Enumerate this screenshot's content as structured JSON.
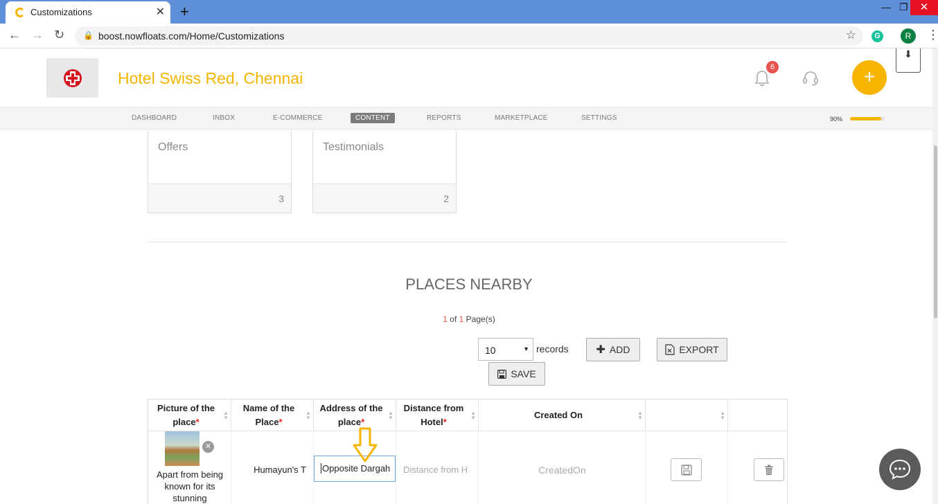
{
  "browser": {
    "tab_title": "Customizations",
    "url": "boost.nowfloats.com/Home/Customizations",
    "profile_initial": "R",
    "grammarly_initial": "G"
  },
  "header": {
    "hotel_name": "Hotel Swiss Red, Chennai",
    "notification_count": "6",
    "brand_color": "#f4b400"
  },
  "nav": {
    "items": [
      "DASHBOARD",
      "INBOX",
      "E-COMMERCE",
      "CONTENT",
      "REPORTS",
      "MARKETPLACE",
      "SETTINGS"
    ],
    "active": "CONTENT",
    "completion_label": "90%",
    "completion_value": 0.9
  },
  "cards": [
    {
      "title": "Offers",
      "count": "3"
    },
    {
      "title": "Testimonials",
      "count": "2"
    }
  ],
  "places": {
    "title": "PLACES NEARBY",
    "pager_current": "1",
    "pager_of": " of ",
    "pager_total": "1",
    "pager_suffix": " Page(s)",
    "records_value": "10",
    "records_label": "records",
    "add_label": "ADD",
    "export_label": "EXPORT",
    "save_label": "SAVE"
  },
  "table": {
    "headers": [
      {
        "label": "Picture of the place",
        "required": true
      },
      {
        "label": "Name of the Place",
        "required": true
      },
      {
        "label": "Address of the place",
        "required": true
      },
      {
        "label": "Distance from Hotel",
        "required": true
      },
      {
        "label": "Created On",
        "required": false
      },
      {
        "label": "",
        "required": false
      },
      {
        "label": "",
        "required": false
      }
    ],
    "row": {
      "picture_description": "Apart from being known for its stunning",
      "name": "Humayun's T",
      "address": "Opposite Dargah",
      "distance_placeholder": "Distance from H",
      "created_on": "CreatedOn"
    }
  }
}
